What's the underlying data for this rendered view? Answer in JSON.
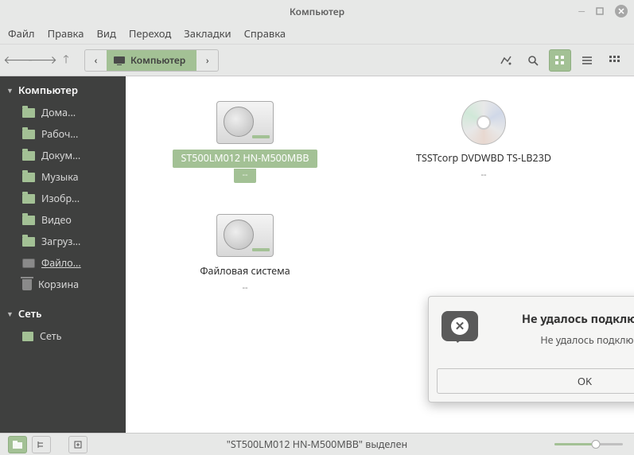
{
  "window": {
    "title": "Компьютер"
  },
  "menu": [
    "Файл",
    "Правка",
    "Вид",
    "Переход",
    "Закладки",
    "Справка"
  ],
  "path": {
    "label": "Компьютер"
  },
  "sidebar": {
    "group1": {
      "title": "Компьютер",
      "items": [
        {
          "label": "Дома...",
          "icon": "folder"
        },
        {
          "label": "Рабоч...",
          "icon": "folder"
        },
        {
          "label": "Докум...",
          "icon": "folder"
        },
        {
          "label": "Музыка",
          "icon": "folder"
        },
        {
          "label": "Изобр...",
          "icon": "folder"
        },
        {
          "label": "Видео",
          "icon": "folder"
        },
        {
          "label": "Загруз...",
          "icon": "folder"
        },
        {
          "label": "Файло...",
          "icon": "hdd",
          "underline": true
        },
        {
          "label": "Корзина",
          "icon": "trash"
        }
      ]
    },
    "group2": {
      "title": "Сеть",
      "items": [
        {
          "label": "Сеть",
          "icon": "net"
        }
      ]
    }
  },
  "files": [
    {
      "name": "ST500LM012 HN-M500MBB",
      "sub": "--",
      "type": "hdd",
      "selected": true
    },
    {
      "name": "TSSTcorp DVDWBD TS-LB23D",
      "sub": "--",
      "type": "cd",
      "selected": false
    },
    {
      "name": "Файловая система",
      "sub": "--",
      "type": "hdd",
      "selected": false
    }
  ],
  "dialog": {
    "title": "Не удалось подключить адрес",
    "message": "Не удалось подключить файл",
    "ok": "OK"
  },
  "status": {
    "text": "\"ST500LM012 HN-M500MBB\" выделен"
  }
}
